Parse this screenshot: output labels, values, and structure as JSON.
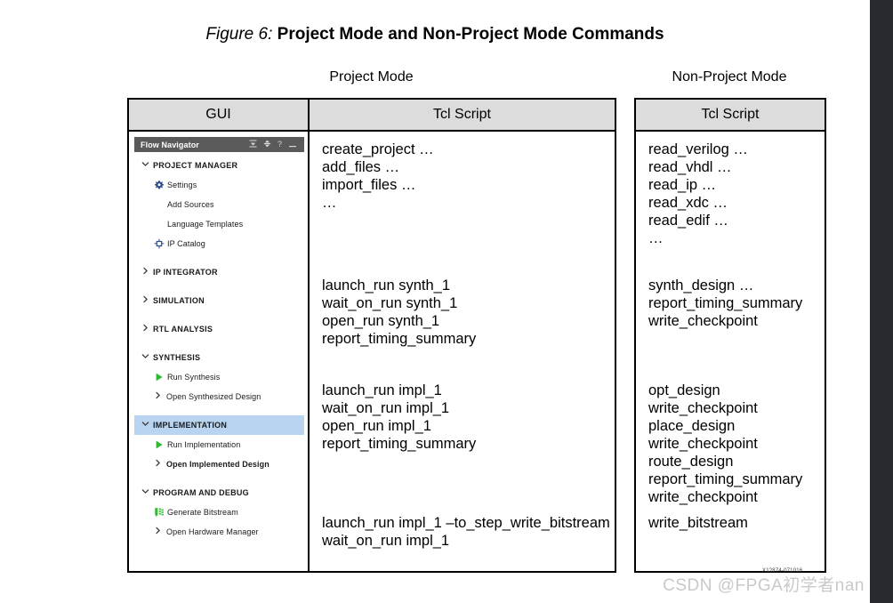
{
  "caption": {
    "figure_label": "Figure 6:",
    "title": "Project Mode and Non-Project Mode Commands"
  },
  "mode_labels": {
    "project": "Project Mode",
    "non_project": "Non-Project Mode"
  },
  "tables": {
    "project": {
      "headers": {
        "gui": "GUI",
        "tcl": "Tcl Script"
      },
      "tcl_blocks": [
        {
          "name": "create-project-block",
          "lines": [
            "create_project …",
            "add_files …",
            "import_files …",
            "…"
          ]
        },
        {
          "name": "synthesis-block",
          "lines": [
            "launch_run synth_1",
            "wait_on_run synth_1",
            "open_run synth_1",
            "report_timing_summary"
          ]
        },
        {
          "name": "implementation-block",
          "lines": [
            "launch_run impl_1",
            "wait_on_run impl_1",
            "open_run impl_1",
            "report_timing_summary"
          ]
        },
        {
          "name": "bitstream-block",
          "lines": [
            "launch_run impl_1 –to_step_write_bitstream",
            "wait_on_run impl_1"
          ]
        }
      ]
    },
    "non_project": {
      "headers": {
        "tcl": "Tcl Script"
      },
      "tcl_blocks": [
        {
          "name": "read-sources-block",
          "lines": [
            "read_verilog …",
            "read_vhdl …",
            "read_ip …",
            "read_xdc …",
            "read_edif …",
            "…"
          ]
        },
        {
          "name": "synthesis-block",
          "lines": [
            "synth_design …",
            "report_timing_summary",
            "write_checkpoint"
          ]
        },
        {
          "name": "implementation-block",
          "lines": [
            "opt_design",
            "write_checkpoint",
            "place_design",
            "write_checkpoint",
            "route_design",
            "report_timing_summary",
            "write_checkpoint"
          ]
        },
        {
          "name": "bitstream-block",
          "lines": [
            "write_bitstream"
          ]
        }
      ]
    }
  },
  "flow_navigator": {
    "title": "Flow Navigator",
    "header_icons": [
      {
        "name": "collapse-all-icon",
        "glyph": "⩝"
      },
      {
        "name": "expand-all-icon",
        "glyph": "⩞"
      },
      {
        "name": "help-icon",
        "glyph": "?"
      },
      {
        "name": "minimize-icon",
        "glyph": "—"
      }
    ],
    "sections": [
      {
        "name": "project-manager",
        "label": "PROJECT MANAGER",
        "expanded": true,
        "chevron": "expanded",
        "selected": false,
        "items": [
          {
            "name": "settings",
            "label": "Settings",
            "icon": "gear-icon",
            "chevron": "none",
            "bold": false
          },
          {
            "name": "add-sources",
            "label": "Add Sources",
            "icon": "none",
            "chevron": "none",
            "bold": false
          },
          {
            "name": "language-templates",
            "label": "Language Templates",
            "icon": "none",
            "chevron": "none",
            "bold": false
          },
          {
            "name": "ip-catalog",
            "label": "IP Catalog",
            "icon": "ip-catalog-icon",
            "chevron": "none",
            "bold": false
          }
        ]
      },
      {
        "name": "ip-integrator",
        "label": "IP INTEGRATOR",
        "expanded": false,
        "chevron": "collapsed",
        "selected": false,
        "items": []
      },
      {
        "name": "simulation",
        "label": "SIMULATION",
        "expanded": false,
        "chevron": "collapsed",
        "selected": false,
        "items": []
      },
      {
        "name": "rtl-analysis",
        "label": "RTL ANALYSIS",
        "expanded": false,
        "chevron": "collapsed",
        "selected": false,
        "items": []
      },
      {
        "name": "synthesis",
        "label": "SYNTHESIS",
        "expanded": true,
        "chevron": "expanded",
        "selected": false,
        "items": [
          {
            "name": "run-synthesis",
            "label": "Run Synthesis",
            "icon": "play-icon",
            "chevron": "none",
            "bold": false
          },
          {
            "name": "open-synthesized-design",
            "label": "Open Synthesized Design",
            "icon": "none",
            "chevron": "collapsed",
            "bold": false
          }
        ]
      },
      {
        "name": "implementation",
        "label": "IMPLEMENTATION",
        "expanded": true,
        "chevron": "expanded",
        "selected": true,
        "items": [
          {
            "name": "run-implementation",
            "label": "Run Implementation",
            "icon": "play-icon",
            "chevron": "none",
            "bold": false
          },
          {
            "name": "open-implemented-design",
            "label": "Open Implemented Design",
            "icon": "none",
            "chevron": "collapsed",
            "bold": true
          }
        ]
      },
      {
        "name": "program-and-debug",
        "label": "PROGRAM AND DEBUG",
        "expanded": true,
        "chevron": "expanded",
        "selected": false,
        "items": [
          {
            "name": "generate-bitstream",
            "label": "Generate Bitstream",
            "icon": "bitstream-icon",
            "chevron": "none",
            "bold": false
          },
          {
            "name": "open-hardware-manager",
            "label": "Open Hardware Manager",
            "icon": "none",
            "chevron": "collapsed",
            "bold": false
          }
        ]
      }
    ]
  },
  "watermarks": {
    "csdn": "CSDN @FPGA初学者nan",
    "figure_id": "X12874-071016"
  },
  "colors": {
    "header_fill": "#dcdcdc",
    "panel_header": "#5a5a5a",
    "selection": "#b8d4f0",
    "play_green": "#2eb82e",
    "icon_blue": "#2b4a8b",
    "border": "#000000",
    "edge_bar": "#272a2e"
  }
}
